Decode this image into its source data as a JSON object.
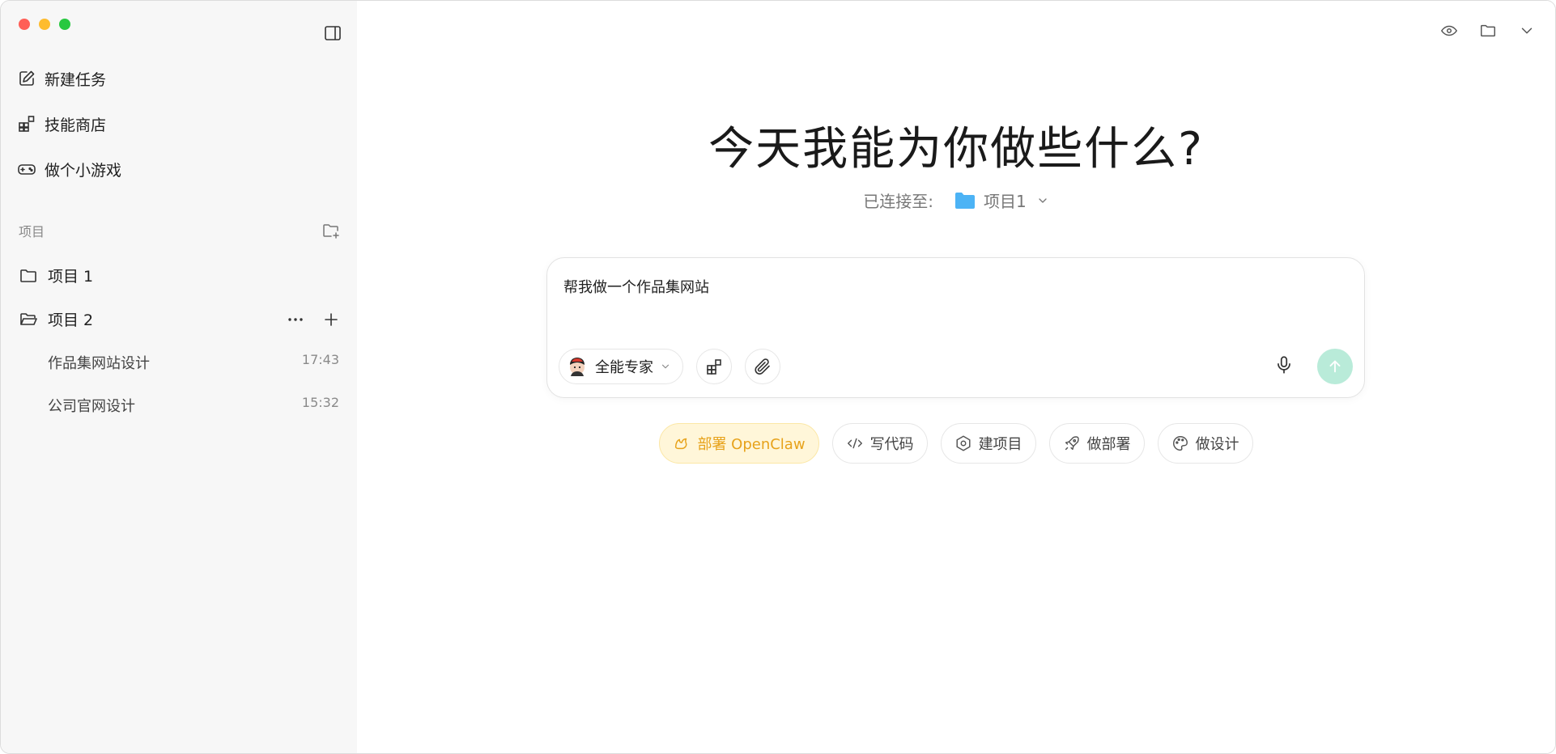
{
  "sidebar": {
    "nav": [
      {
        "label": "新建任务",
        "icon": "edit-icon"
      },
      {
        "label": "技能商店",
        "icon": "grid-icon"
      },
      {
        "label": "做个小游戏",
        "icon": "gamepad-icon"
      }
    ],
    "projects_heading": "项目",
    "projects": [
      {
        "label": "项目 1",
        "icon": "folder-icon"
      },
      {
        "label": "项目 2",
        "icon": "folder-open-icon"
      }
    ],
    "tasks": [
      {
        "title": "作品集网站设计",
        "time": "17:43"
      },
      {
        "title": "公司官网设计",
        "time": "15:32"
      }
    ]
  },
  "main": {
    "headline": "今天我能为你做些什么?",
    "connected_label": "已连接至:",
    "connected_project": "项目1",
    "composer": {
      "prompt": "帮我做一个作品集网站",
      "agent_label": "全能专家"
    },
    "chips": [
      {
        "label": "部署 OpenClaw",
        "icon": "claw-icon"
      },
      {
        "label": "写代码",
        "icon": "code-icon"
      },
      {
        "label": "建项目",
        "icon": "hexagon-icon"
      },
      {
        "label": "做部署",
        "icon": "rocket-icon"
      },
      {
        "label": "做设计",
        "icon": "palette-icon"
      }
    ]
  },
  "colors": {
    "sidebar_bg": "#f7f7f7",
    "accent_send": "#b9ebd9",
    "highlight_chip_bg": "#fff6d9",
    "highlight_chip_text": "#e7a21a",
    "folder_blue": "#4cb3f5"
  }
}
